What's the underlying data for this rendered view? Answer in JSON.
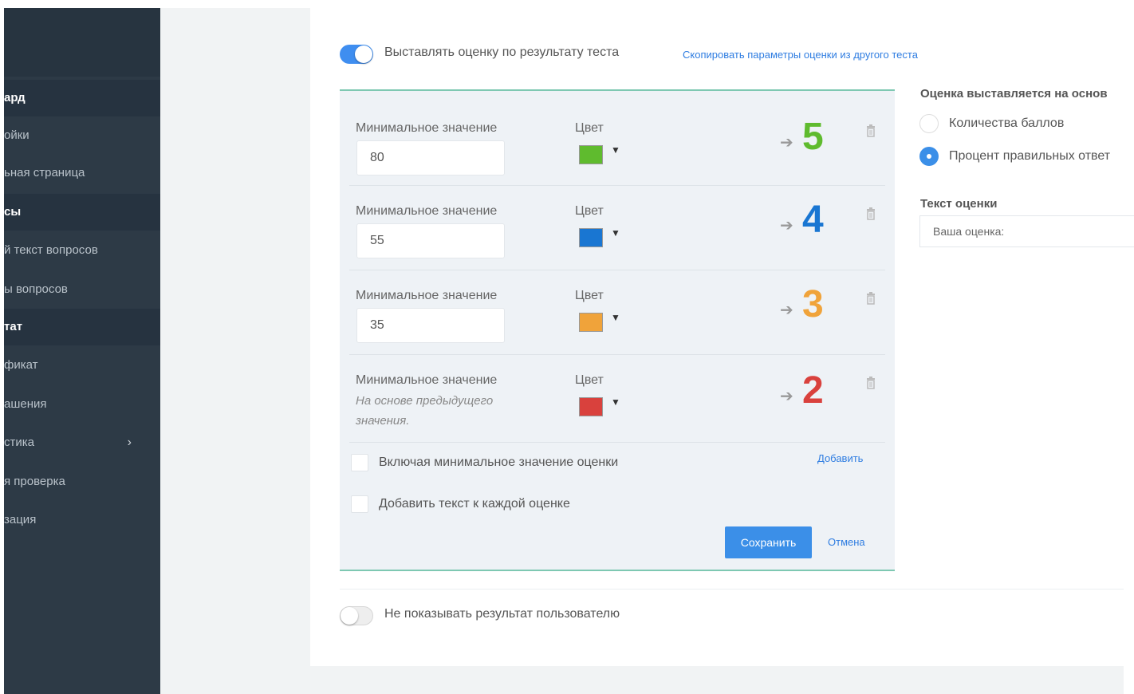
{
  "sidebar": {
    "items": [
      {
        "label": "ард",
        "head": true
      },
      {
        "label": "ойки",
        "head": false
      },
      {
        "label": "ьная страница",
        "head": false
      },
      {
        "label": "сы",
        "head": true
      },
      {
        "label": "й текст вопросов",
        "head": false
      },
      {
        "label": "ы вопросов",
        "head": false
      },
      {
        "label": "тат",
        "head": true
      },
      {
        "label": "фикат",
        "head": false
      },
      {
        "label": "ашения",
        "head": false
      },
      {
        "label": "стика",
        "head": false,
        "chevron": "›"
      },
      {
        "label": "я проверка",
        "head": false
      },
      {
        "label": "зация",
        "head": false
      }
    ]
  },
  "grading": {
    "toggle_label": "Выставлять оценку по результату теста",
    "toggle_on": true,
    "copy_link": "Скопировать параметры оценки из другого теста",
    "rows": [
      {
        "min_label": "Минимальное значение",
        "value": "80",
        "color_label": "Цвет",
        "color": "#5fbb2e",
        "grade": "5",
        "grade_color": "#5fbb2e"
      },
      {
        "min_label": "Минимальное значение",
        "value": "55",
        "color_label": "Цвет",
        "color": "#1976d2",
        "grade": "4",
        "grade_color": "#1976d2"
      },
      {
        "min_label": "Минимальное значение",
        "value": "35",
        "color_label": "Цвет",
        "color": "#f0a33a",
        "grade": "3",
        "grade_color": "#f0a33a"
      },
      {
        "min_label": "Минимальное значение",
        "hint": "На основе предыдущего значения.",
        "color_label": "Цвет",
        "color": "#d9413d",
        "grade": "2",
        "grade_color": "#d9413d"
      }
    ],
    "include_min_label": "Включая минимальное значение оценки",
    "add_link": "Добавить",
    "add_text_label": "Добавить текст к каждой оценке",
    "save_label": "Сохранить",
    "cancel_label": "Отмена"
  },
  "basis": {
    "title": "Оценка выставляется на основ",
    "options": [
      {
        "label": "Количества баллов",
        "selected": false
      },
      {
        "label": "Процент правильных ответ",
        "selected": true
      }
    ],
    "text_title": "Текст оценки",
    "text_value": "Ваша оценка:"
  },
  "hide_result": {
    "label": "Не показывать результат пользователю",
    "toggle_on": false
  }
}
